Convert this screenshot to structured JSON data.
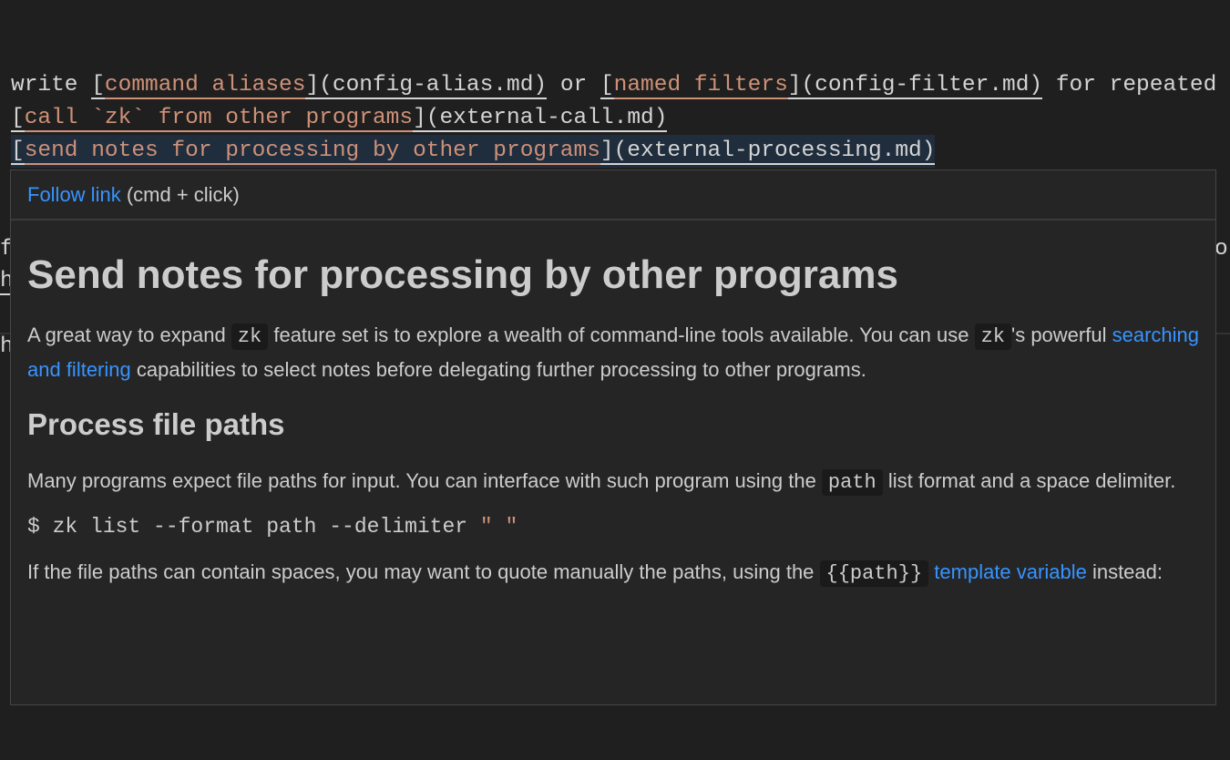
{
  "editor": {
    "line1": {
      "pre": "write ",
      "l1_text": "command aliases",
      "l1_target": "(config-alias.md)",
      "mid": " or ",
      "l2_text": "named filters",
      "l2_target": "(config-filter.md)",
      "post": " for repeated co"
    },
    "line2": {
      "text": "call `zk` from other programs",
      "target": "(external-call.md)"
    },
    "line3": {
      "text": "send notes for processing by other programs",
      "target": "(external-processing.md)"
    },
    "fragments": {
      "a": "f",
      "b": "h",
      "c": "h",
      "d": "or"
    }
  },
  "hover": {
    "follow_link": "Follow link",
    "follow_hint": " (cmd + click)",
    "title": "Send notes for processing by other programs",
    "p1": {
      "a": "A great way to expand ",
      "code1": "zk",
      "b": " feature set is to explore a wealth of command-line tools available. You can use ",
      "code2": "zk",
      "c": "'s powerful ",
      "link": "searching and filtering",
      "d": " capabilities to select notes before delegating further processing to other programs."
    },
    "h2": "Process file paths",
    "p2": {
      "a": "Many programs expect file paths for input. You can interface with such program using the ",
      "code": "path",
      "b": " list format and a space delimiter."
    },
    "command": {
      "text": "$ zk list --format path --delimiter ",
      "string": "\" \""
    },
    "p3": {
      "a": "If the file paths can contain spaces, you may want to quote manually the paths, using the ",
      "code": "{{path}}",
      "b": " ",
      "link": "template variable",
      "c": " instead:"
    }
  },
  "colors": {
    "link": "#3794ff",
    "markdown_link_text": "#ce9178",
    "background": "#1f1f1f",
    "hover_background": "#252526"
  }
}
